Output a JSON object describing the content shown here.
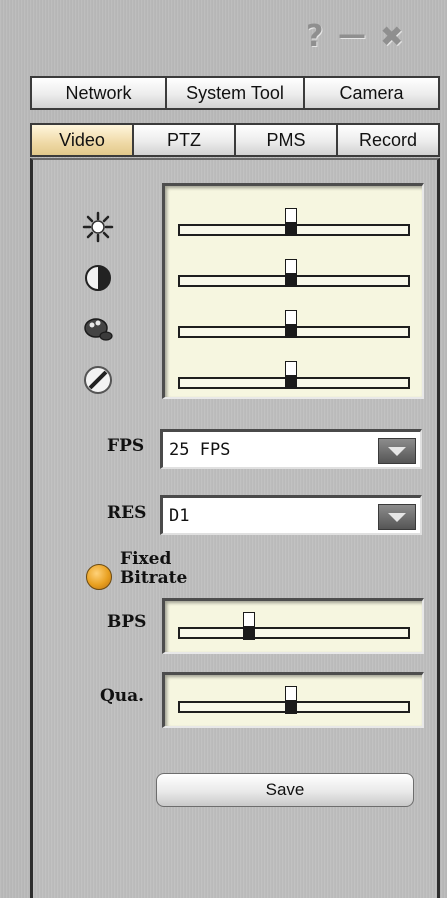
{
  "window_controls": {
    "help": "?",
    "minimize": "—",
    "close": "✖"
  },
  "top_tabs": [
    {
      "label": "Network"
    },
    {
      "label": "System Tool"
    },
    {
      "label": "Camera"
    }
  ],
  "sub_tabs": [
    {
      "label": "Video",
      "active": true
    },
    {
      "label": "PTZ"
    },
    {
      "label": "PMS"
    },
    {
      "label": "Record"
    }
  ],
  "image_adjust": {
    "sliders": [
      {
        "icon": "brightness-icon",
        "level": 0.5
      },
      {
        "icon": "contrast-icon",
        "level": 0.5
      },
      {
        "icon": "color-palette-icon",
        "level": 0.5
      },
      {
        "icon": "sharpness-icon",
        "level": 0.5
      }
    ]
  },
  "fps": {
    "label": "FPS",
    "value": "25 FPS"
  },
  "res": {
    "label": "RES",
    "value": "D1"
  },
  "bitrate_mode": {
    "line1": "Fixed",
    "line2": "Bitrate",
    "selected": true
  },
  "bps": {
    "label": "BPS",
    "level": 0.31
  },
  "quality": {
    "label": "Qua.",
    "level": 0.5
  },
  "save": {
    "label": "Save"
  },
  "colors": {
    "active_tab": "#efd9a6",
    "slider_box": "#f6f6e0",
    "radio": "#e8a020"
  }
}
